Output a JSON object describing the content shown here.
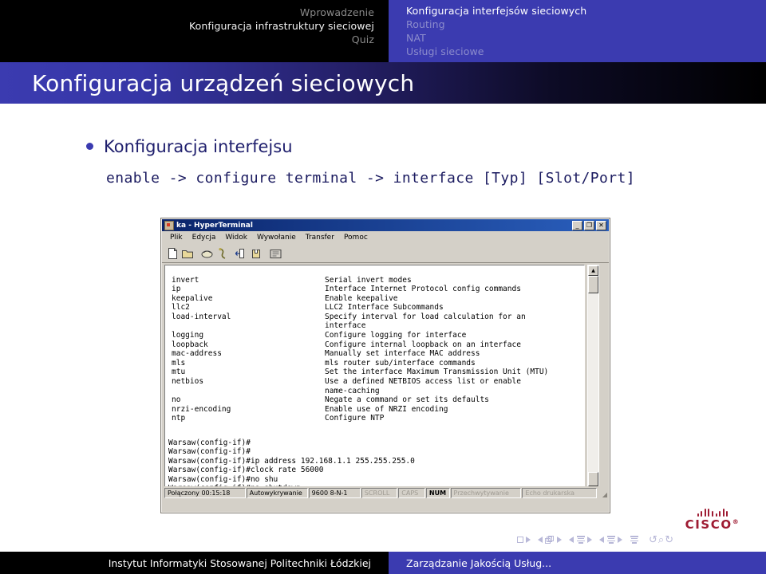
{
  "nav": {
    "left_items": [
      {
        "label": "Wprowadzenie",
        "active": false
      },
      {
        "label": "Konfiguracja infrastruktury sieciowej",
        "active": true
      },
      {
        "label": "Quiz",
        "active": false
      }
    ],
    "right_items": [
      {
        "label": "Konfiguracja interfejsów sieciowych",
        "active": true
      },
      {
        "label": "Routing",
        "active": false
      },
      {
        "label": "NAT",
        "active": false
      },
      {
        "label": "Usługi sieciowe",
        "active": false
      }
    ]
  },
  "slide": {
    "title": "Konfiguracja urządzeń sieciowych",
    "bullet": "Konfiguracja interfejsu",
    "command": "enable -> configure terminal -> interface [Typ] [Slot/Port]"
  },
  "hyperterminal": {
    "window_title": "ka - HyperTerminal",
    "window_buttons": [
      "_",
      "❐",
      "✕"
    ],
    "menu": [
      "Plik",
      "Edycja",
      "Widok",
      "Wywołanie",
      "Transfer",
      "Pomoc"
    ],
    "toolbar_icons": [
      "new-document-icon",
      "open-folder-icon",
      "call-phone-icon",
      "disconnect-icon",
      "send-file-icon",
      "receive-file-icon",
      "properties-icon"
    ],
    "terminal": {
      "commands_column": "invert\nip\nkeepalive\nllc2\nload-interval\n\nlogging\nloopback\nmac-address\nmls\nmtu\nnetbios\n\nno\nnrzi-encoding\nntp",
      "descriptions_column": "Serial invert modes\nInterface Internet Protocol config commands\nEnable keepalive\nLLC2 Interface Subcommands\nSpecify interval for load calculation for an\ninterface\nConfigure logging for interface\nConfigure internal loopback on an interface\nManually set interface MAC address\nmls router sub/interface commands\nSet the interface Maximum Transmission Unit (MTU)\nUse a defined NETBIOS access list or enable\nname-caching\nNegate a command or set its defaults\nEnable use of NRZI encoding\nConfigure NTP",
      "prompt_lines": "Warsaw(config-if)#\nWarsaw(config-if)#\nWarsaw(config-if)#ip address 192.168.1.1 255.255.255.0\nWarsaw(config-if)#clock rate 56000\nWarsaw(config-if)#no shu\nWarsaw(config-if)#no shutdown\nWarsaw(config-if)#_"
    },
    "statusbar": {
      "connected": "Połączony 00:15:18",
      "detection": "Autowykrywanie",
      "line_settings": "9600 8-N-1",
      "scroll": "SCROLL",
      "caps": "CAPS",
      "num": "NUM",
      "capture": "Przechwytywanie",
      "printer_echo": "Echo drukarska"
    }
  },
  "logo": {
    "text": "CISCO",
    "trademark": "®",
    "color": "#9e1b32"
  },
  "footer": {
    "left": "Instytut Informatyki Stosowanej Politechniki Łódzkiej",
    "right": "Zarządzanie Jakością Usług..."
  },
  "colors": {
    "accent_blue": "#3b3bb0",
    "title_text": "#20206e",
    "nav_black": "#000000"
  }
}
